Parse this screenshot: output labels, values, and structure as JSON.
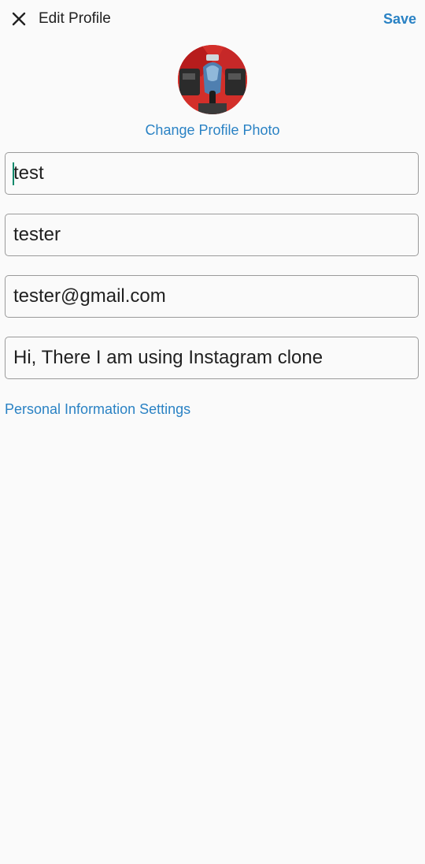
{
  "header": {
    "close_icon": "close-icon",
    "title": "Edit Profile",
    "save_label": "Save"
  },
  "profile": {
    "avatar_icon": "profile-photo",
    "change_photo_label": "Change Profile Photo"
  },
  "form": {
    "name": "test",
    "username": "tester",
    "email": "tester@gmail.com",
    "bio": "Hi, There I am using Instagram clone"
  },
  "links": {
    "personal_info": "Personal Information Settings"
  },
  "colors": {
    "accent": "#2a82c4",
    "background": "#fafafa",
    "caret": "#0e8a6c"
  }
}
